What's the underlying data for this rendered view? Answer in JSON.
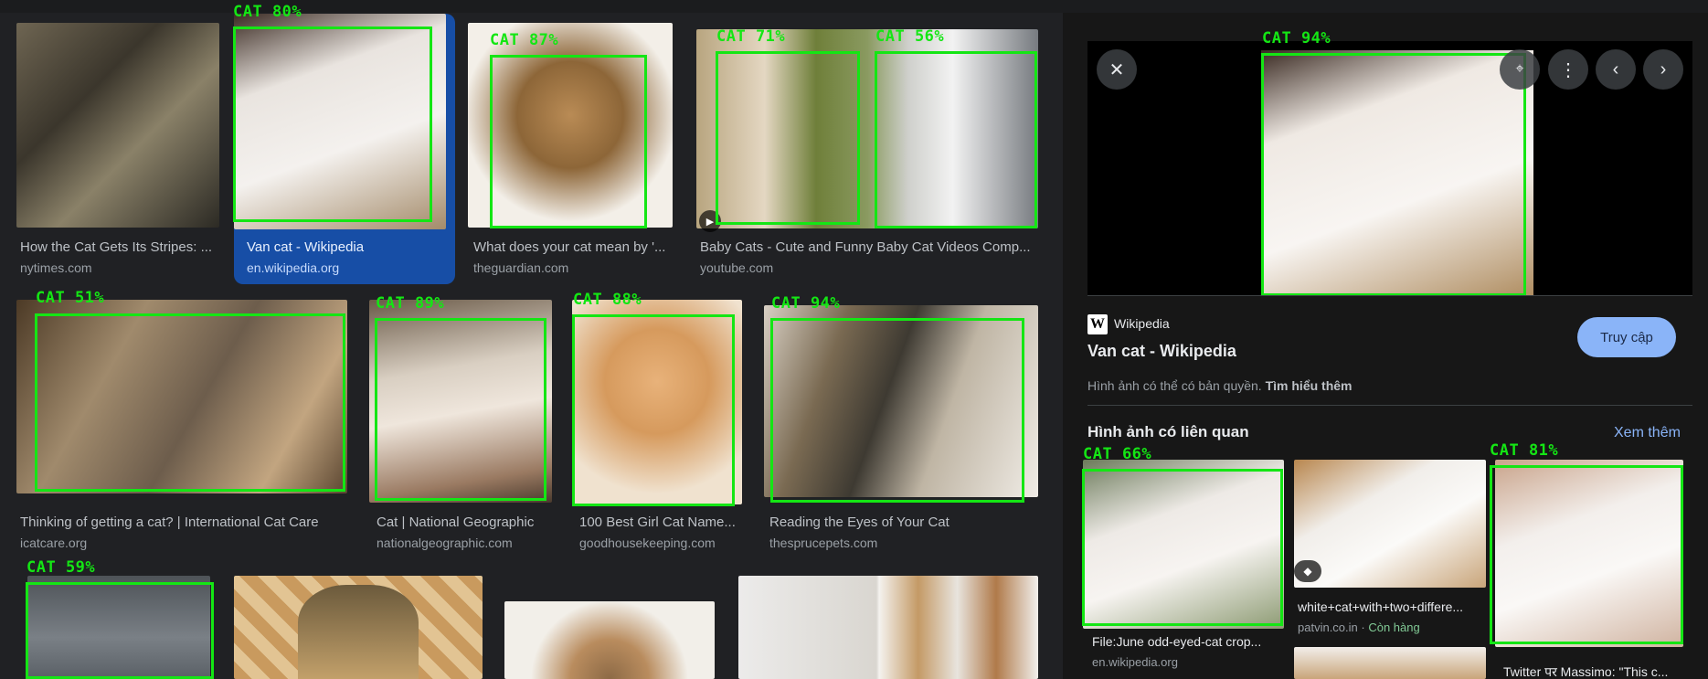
{
  "results": [
    {
      "title": "How the Cat Gets Its Stripes: ...",
      "source": "nytimes.com"
    },
    {
      "title": "Van cat - Wikipedia",
      "source": "en.wikipedia.org"
    },
    {
      "title": "What does your cat mean by '...",
      "source": "theguardian.com"
    },
    {
      "title": "Baby Cats - Cute and Funny Baby Cat Videos Comp...",
      "source": "youtube.com"
    },
    {
      "title": "Thinking of getting a cat? | International Cat Care",
      "source": "icatcare.org"
    },
    {
      "title": "Cat | National Geographic",
      "source": "nationalgeographic.com"
    },
    {
      "title": "100 Best Girl Cat Name...",
      "source": "goodhousekeeping.com"
    },
    {
      "title": "Reading the Eyes of Your Cat",
      "source": "thesprucepets.com"
    }
  ],
  "detections": {
    "r1": "CAT 80%",
    "r2": "CAT 87%",
    "r3a": "CAT 71%",
    "r3b": "CAT 56%",
    "r4": "CAT 51%",
    "r5": "CAT 89%",
    "r6": "CAT 88%",
    "r7": "CAT 94%",
    "r8": "CAT 59%",
    "preview": "CAT 94%",
    "rel1": "CAT 66%",
    "rel3": "CAT 81%"
  },
  "panel": {
    "site_logo": "W",
    "site_name": "Wikipedia",
    "title": "Van cat - Wikipedia",
    "visit_label": "Truy cập",
    "copyright_text": "Hình ảnh có thể có bản quyền.",
    "learn_more": "Tìm hiểu thêm",
    "related_heading": "Hình ảnh có liên quan",
    "see_more": "Xem thêm",
    "related": [
      {
        "title": "File:June odd-eyed-cat crop...",
        "source": "en.wikipedia.org"
      },
      {
        "title": "white+cat+with+two+differe...",
        "source": "patvin.co.in",
        "stock": "Còn hàng"
      },
      {
        "title": "Twitter पर Massimo: \"This c...",
        "source": ""
      }
    ]
  },
  "icons": {
    "close": "close-icon",
    "lens": "lens-icon",
    "more": "more-vert-icon",
    "prev": "chevron-left-icon",
    "next": "chevron-right-icon",
    "play": "play-icon",
    "tag": "price-tag-icon"
  },
  "colors": {
    "background": "#202124",
    "panel": "#171717",
    "selected_card": "#174ea6",
    "detection": "#14e614",
    "link": "#8ab4f8"
  }
}
